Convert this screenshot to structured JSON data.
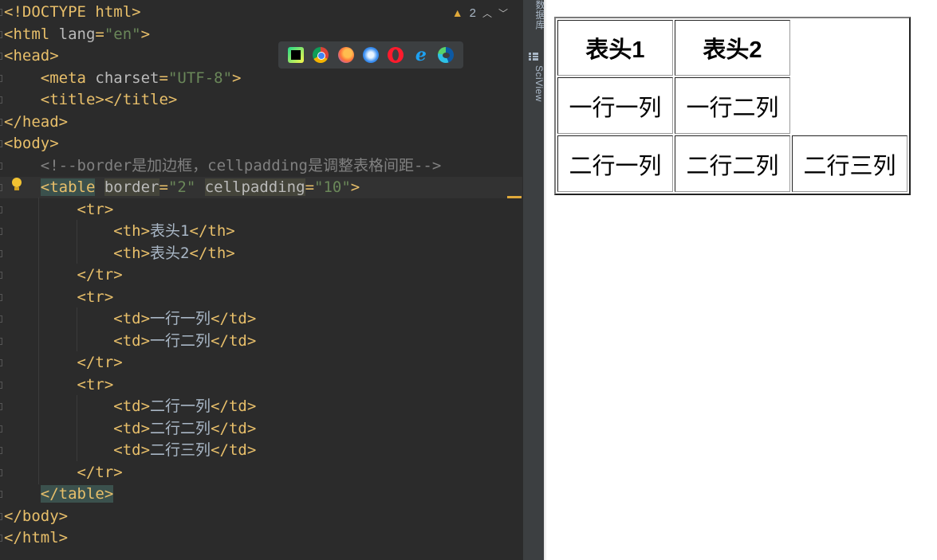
{
  "editor": {
    "lines": [
      [
        {
          "c": "tag",
          "t": "<!DOCTYPE html>"
        }
      ],
      [
        {
          "c": "tag",
          "t": "<html "
        },
        {
          "c": "attr",
          "t": "lang"
        },
        {
          "c": "tag",
          "t": "="
        },
        {
          "c": "str",
          "t": "\"en\""
        },
        {
          "c": "tag",
          "t": ">"
        }
      ],
      [
        {
          "c": "tag",
          "t": "<head>"
        }
      ],
      [
        {
          "c": "text",
          "t": "    "
        },
        {
          "c": "tag",
          "t": "<meta "
        },
        {
          "c": "attr",
          "t": "charset"
        },
        {
          "c": "tag",
          "t": "="
        },
        {
          "c": "str",
          "t": "\"UTF-8\""
        },
        {
          "c": "tag",
          "t": ">"
        }
      ],
      [
        {
          "c": "text",
          "t": "    "
        },
        {
          "c": "tag",
          "t": "<title></title>"
        }
      ],
      [
        {
          "c": "tag",
          "t": "</head>"
        }
      ],
      [
        {
          "c": "tag",
          "t": "<body>"
        }
      ],
      [
        {
          "c": "text",
          "t": "    "
        },
        {
          "c": "comment",
          "t": "<!--border是加边框，cellpadding是调整表格间距-->"
        }
      ],
      [
        {
          "c": "text",
          "t": "    "
        },
        {
          "c": "tag hl-tag",
          "t": "<table"
        },
        {
          "c": "text",
          "t": " "
        },
        {
          "c": "attr hl-attr",
          "t": "border"
        },
        {
          "c": "tag",
          "t": "="
        },
        {
          "c": "str",
          "t": "\"2\""
        },
        {
          "c": "text",
          "t": " "
        },
        {
          "c": "attr hl-attr",
          "t": "cellpadding"
        },
        {
          "c": "tag",
          "t": "="
        },
        {
          "c": "str",
          "t": "\"10\""
        },
        {
          "c": "tag",
          "t": ">"
        }
      ],
      [
        {
          "c": "text",
          "t": "        "
        },
        {
          "c": "tag",
          "t": "<tr>"
        }
      ],
      [
        {
          "c": "text",
          "t": "            "
        },
        {
          "c": "tag",
          "t": "<th>"
        },
        {
          "c": "text",
          "t": "表头1"
        },
        {
          "c": "tag",
          "t": "</th>"
        }
      ],
      [
        {
          "c": "text",
          "t": "            "
        },
        {
          "c": "tag",
          "t": "<th>"
        },
        {
          "c": "text",
          "t": "表头2"
        },
        {
          "c": "tag",
          "t": "</th>"
        }
      ],
      [
        {
          "c": "text",
          "t": "        "
        },
        {
          "c": "tag",
          "t": "</tr>"
        }
      ],
      [
        {
          "c": "text",
          "t": "        "
        },
        {
          "c": "tag",
          "t": "<tr>"
        }
      ],
      [
        {
          "c": "text",
          "t": "            "
        },
        {
          "c": "tag",
          "t": "<td>"
        },
        {
          "c": "text",
          "t": "一行一列"
        },
        {
          "c": "tag",
          "t": "</td>"
        }
      ],
      [
        {
          "c": "text",
          "t": "            "
        },
        {
          "c": "tag",
          "t": "<td>"
        },
        {
          "c": "text",
          "t": "一行二列"
        },
        {
          "c": "tag",
          "t": "</td>"
        }
      ],
      [
        {
          "c": "text",
          "t": "        "
        },
        {
          "c": "tag",
          "t": "</tr>"
        }
      ],
      [
        {
          "c": "text",
          "t": "        "
        },
        {
          "c": "tag",
          "t": "<tr>"
        }
      ],
      [
        {
          "c": "text",
          "t": "            "
        },
        {
          "c": "tag",
          "t": "<td>"
        },
        {
          "c": "text",
          "t": "二行一列"
        },
        {
          "c": "tag",
          "t": "</td>"
        }
      ],
      [
        {
          "c": "text",
          "t": "            "
        },
        {
          "c": "tag",
          "t": "<td>"
        },
        {
          "c": "text",
          "t": "二行二列"
        },
        {
          "c": "tag",
          "t": "</td>"
        }
      ],
      [
        {
          "c": "text",
          "t": "            "
        },
        {
          "c": "tag",
          "t": "<td>"
        },
        {
          "c": "text",
          "t": "二行三列"
        },
        {
          "c": "tag",
          "t": "</td>"
        }
      ],
      [
        {
          "c": "text",
          "t": "        "
        },
        {
          "c": "tag",
          "t": "</tr>"
        }
      ],
      [
        {
          "c": "text",
          "t": "    "
        },
        {
          "c": "tag hl-tag",
          "t": "</table>"
        }
      ],
      [
        {
          "c": "tag",
          "t": "</body>"
        }
      ],
      [
        {
          "c": "tag",
          "t": "</html>"
        }
      ]
    ],
    "current_line_index": 8,
    "inspection": {
      "warning_count": "2",
      "up_label": "^",
      "down_label": "v"
    }
  },
  "browser_bar": {
    "icons": [
      "pycharm-icon",
      "chrome-icon",
      "firefox-icon",
      "safari-icon",
      "opera-icon",
      "ie-icon",
      "edge-icon"
    ]
  },
  "side_panel": {
    "database_label": "数据库",
    "sciview_label": "SciView"
  },
  "preview_table": {
    "headers": [
      "表头1",
      "表头2"
    ],
    "rows": [
      [
        "一行一列",
        "一行二列"
      ],
      [
        "二行一列",
        "二行二列",
        "二行三列"
      ]
    ]
  },
  "colors": {
    "editor_bg": "#2b2b2b",
    "tag": "#e8bf6a",
    "string": "#6a8759",
    "comment": "#808080",
    "warning": "#e0a93a"
  }
}
